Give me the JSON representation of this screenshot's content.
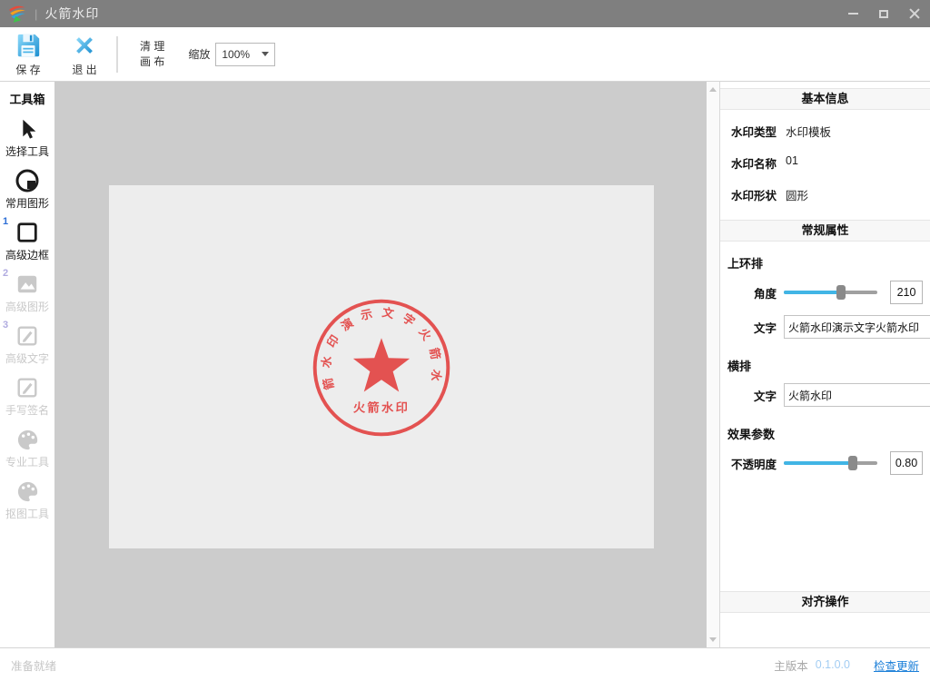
{
  "window": {
    "title": "火箭水印"
  },
  "toolbar": {
    "save_label": "保 存",
    "exit_label": "退 出",
    "clear_line1": "清 理",
    "clear_line2": "画 布",
    "zoom_label": "缩放",
    "zoom_value": "100%"
  },
  "toolbox": {
    "header": "工具箱",
    "items": [
      {
        "label": "选择工具",
        "badge": ""
      },
      {
        "label": "常用图形",
        "badge": ""
      },
      {
        "label": "高级边框",
        "badge": "1"
      },
      {
        "label": "高级图形",
        "badge": "2"
      },
      {
        "label": "高级文字",
        "badge": "3"
      },
      {
        "label": "手写签名",
        "badge": ""
      },
      {
        "label": "专业工具",
        "badge": ""
      },
      {
        "label": "抠图工具",
        "badge": ""
      }
    ]
  },
  "canvas": {
    "stamp": {
      "ring_text": "火箭水印演示文字火箭水印",
      "center_text": "火箭水印",
      "color": "#e23d3c"
    }
  },
  "panel": {
    "headers": {
      "basic": "基本信息",
      "general": "常规属性",
      "align": "对齐操作"
    },
    "info": [
      {
        "label": "水印类型",
        "value": "水印模板"
      },
      {
        "label": "水印名称",
        "value": "01"
      },
      {
        "label": "水印形状",
        "value": "圆形"
      }
    ],
    "upper_ring": {
      "title": "上环排",
      "angle_label": "角度",
      "angle_value": "210",
      "angle_percent": "61%",
      "text_label": "文字",
      "text_value": "火箭水印演示文字火箭水印"
    },
    "horizontal": {
      "title": "横排",
      "text_label": "文字",
      "text_value": "火箭水印"
    },
    "effect": {
      "title": "效果参数",
      "opacity_label": "不透明度",
      "opacity_value": "0.80",
      "opacity_percent": "74%"
    }
  },
  "statusbar": {
    "ready": "准备就绪",
    "version_label": "主版本",
    "version": "0.1.0.0",
    "update_link": "检查更新"
  },
  "colors": {
    "accent_blue": "#41b5e5",
    "stamp_red": "#e23d3c",
    "titlebar_gray": "#7f7f7f"
  }
}
